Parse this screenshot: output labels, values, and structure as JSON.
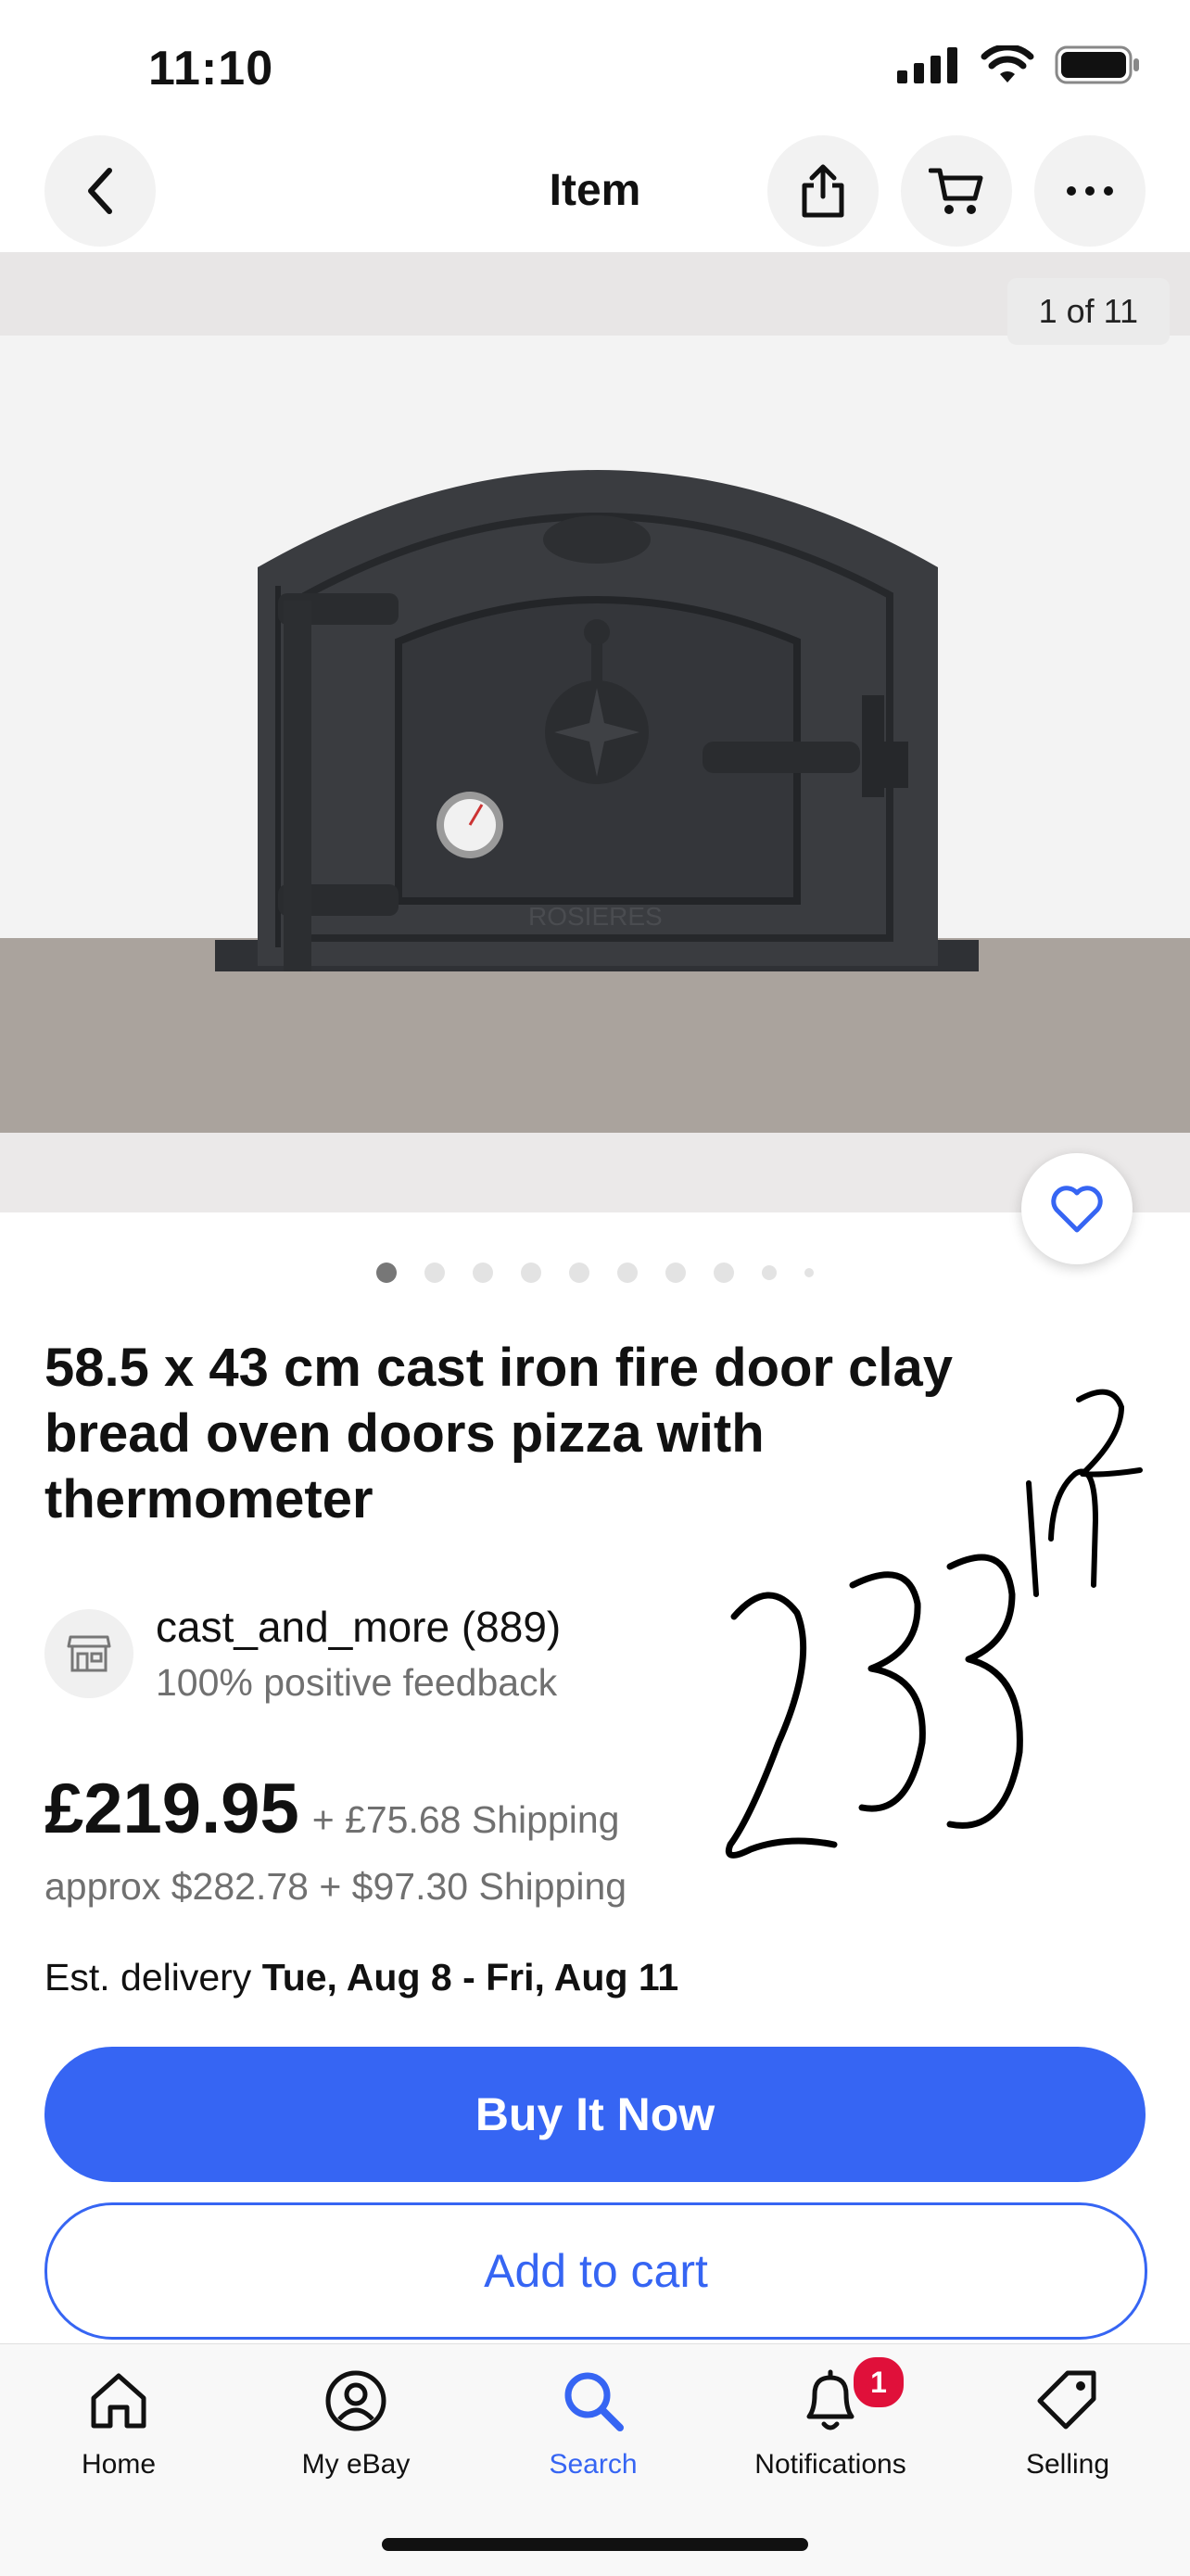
{
  "status_bar": {
    "time": "11:10"
  },
  "nav": {
    "title": "Item"
  },
  "gallery": {
    "counter": "1 of 11",
    "image_brand_text": "ROSIERES"
  },
  "item": {
    "title": "58.5 x 43 cm cast iron fire door clay bread oven doors pizza with thermometer",
    "seller_name": "cast_and_more (889)",
    "seller_feedback": "100% positive feedback",
    "price": "£219.95",
    "shipping": "+ £75.68 Shipping",
    "approx": "approx $282.78 + $97.30 Shipping",
    "delivery_label": "Est. delivery ",
    "delivery_dates": "Tue, Aug 8 - Fri, Aug 11"
  },
  "actions": {
    "buy_now": "Buy It Now",
    "add_to_cart": "Add to cart"
  },
  "handwriting": {
    "text": "233",
    "superscript": "in",
    "exponent": "2"
  },
  "tabs": [
    {
      "label": "Home",
      "icon": "home-icon"
    },
    {
      "label": "My eBay",
      "icon": "user-icon"
    },
    {
      "label": "Search",
      "icon": "search-icon"
    },
    {
      "label": "Notifications",
      "icon": "bell-icon",
      "badge": "1"
    },
    {
      "label": "Selling",
      "icon": "tag-icon"
    }
  ],
  "colors": {
    "accent": "#3665f3",
    "badge": "#e0103a",
    "muted": "#707070"
  }
}
